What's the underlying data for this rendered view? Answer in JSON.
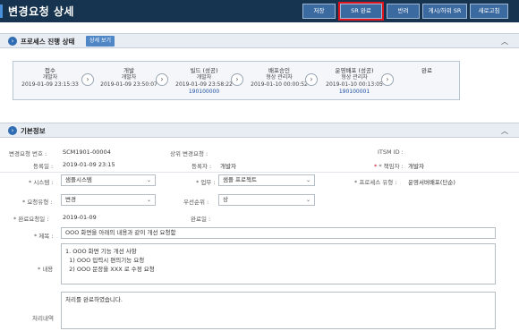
{
  "header": {
    "title": "변경요청 상세",
    "buttons": [
      "저장",
      "SR 완료",
      "반려",
      "게시/하위 SR",
      "새로고침"
    ]
  },
  "process_panel": {
    "title": "프로세스 진행 상태",
    "detail_button": "상세 보기",
    "steps": [
      {
        "name": "접수",
        "role": "개발자",
        "date": "2019-01-09 23:15:33",
        "id": ""
      },
      {
        "name": "개발",
        "role": "개발자",
        "date": "2019-01-09 23:50:07",
        "id": ""
      },
      {
        "name": "빌드 (성공)",
        "role": "개발자",
        "date": "2019-01-09 23:58:22",
        "id": "190100000"
      },
      {
        "name": "배포승인",
        "role": "형상 관리자",
        "date": "2019-01-10 00:00:52",
        "id": ""
      },
      {
        "name": "운영배포 (성공)",
        "role": "형상 관리자",
        "date": "2019-01-10 00:13:05",
        "id": "190100001"
      },
      {
        "name": "완료",
        "role": "",
        "date": "",
        "id": ""
      }
    ]
  },
  "basic_panel": {
    "title": "기본정보",
    "fields": {
      "change_no_label": "변경요청 번호 :",
      "change_no": "SCM1901-00004",
      "parent_label": "상위 변경요청 :",
      "itsm_label": "ITSM ID :",
      "reg_date_label": "등록일 :",
      "reg_date": "2019-01-09 23:15",
      "registrant_label": "등록자 :",
      "registrant": "개발자",
      "owner_label": "* 책임자 :",
      "owner": "개발자",
      "system_label": "* 시스템 :",
      "system": "샘플시스템",
      "work_label": "* 업무 :",
      "work": "샘플 프로젝트",
      "process_type_label": "* 프로세스 유형 :",
      "process_type": "운영서버배포(단순)",
      "req_type_label": "* 요청유형 :",
      "req_type": "변경",
      "priority_label": "우선순위 :",
      "priority": "상",
      "due_label": "* 완료요청일 :",
      "due": "2019-01-09",
      "complete_label": "완료일 :",
      "subject_label": "* 제목 :",
      "subject": "OOO 화면을 아래의 내용과 같이 개선 요청함",
      "content_label": "* 내용",
      "content_lines": [
        "1. OOO 화면 기능 개선 사항",
        "  1) OOO 입력시 편의기능 요청",
        "  2) OOO 문장을 XXX 로 수정 요청"
      ],
      "handling_label": "처리내역",
      "handling": "처리를 완료하였습니다."
    }
  },
  "icons": {
    "panel_marker": "chevron-right-circle-icon",
    "collapse": "chevron-up-icon",
    "step_arrow": "chevron-right-icon",
    "dropdown": "chevron-down-icon"
  },
  "colors": {
    "topbar": "#16344f",
    "button": "#3b6aa0",
    "highlight": "#e0141e",
    "link_id": "#1d4fa0"
  }
}
